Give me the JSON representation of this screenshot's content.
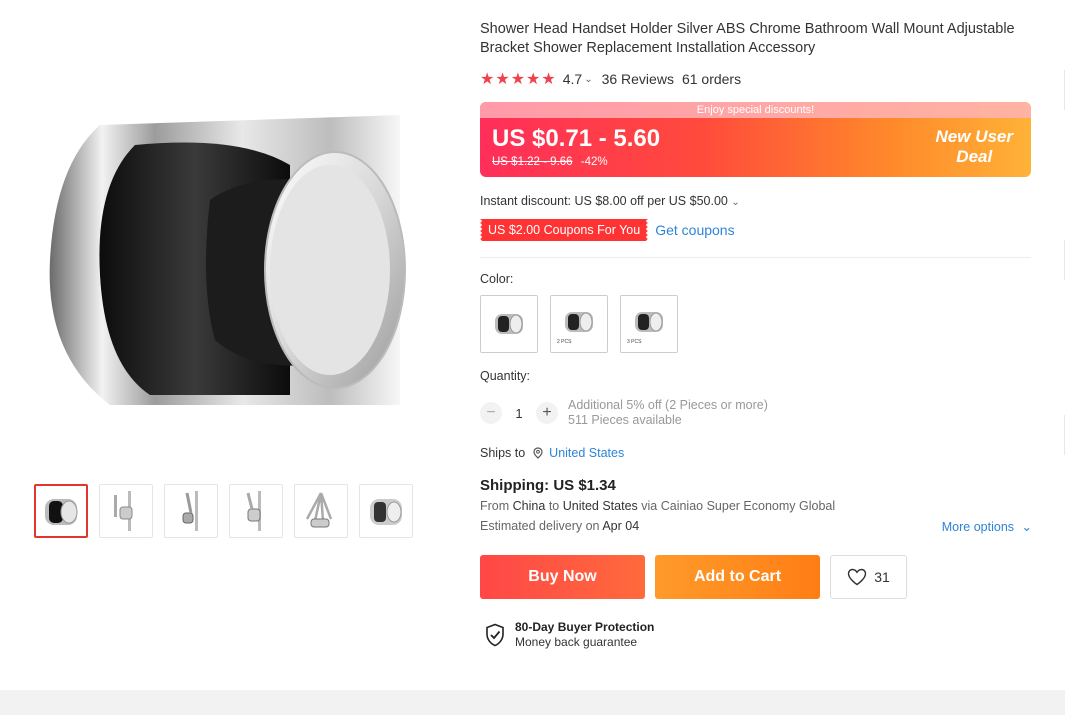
{
  "product": {
    "title": "Shower Head Handset Holder Silver ABS Chrome Bathroom Wall Mount Adjustable Bracket Shower Replacement Installation Accessory",
    "stars": "★★★★★",
    "rating": "4.7",
    "reviews": "36 Reviews",
    "orders": "61 orders"
  },
  "price": {
    "banner": "Enjoy special discounts!",
    "range": "US $0.71 - 5.60",
    "original": "US $1.22 - 9.66",
    "discount": "-42%",
    "deal_line1": "New User",
    "deal_line2": "Deal"
  },
  "discounts": {
    "instant": "Instant discount: US $8.00 off per US $50.00",
    "coupon": "US $2.00 Coupons For You",
    "get_coupons": "Get coupons"
  },
  "color": {
    "label": "Color:",
    "options": [
      "",
      "2 PCS",
      "3 PCS"
    ]
  },
  "quantity": {
    "label": "Quantity:",
    "value": "1",
    "minus": "−",
    "plus": "+",
    "note": "Additional 5% off (2 Pieces or more)",
    "available": "511 Pieces available"
  },
  "shipping": {
    "ships_to_label": "Ships to",
    "country": "United States",
    "title": "Shipping: US $1.34",
    "from_prefix": "From",
    "from": "China",
    "to_word": "to",
    "to": "United States",
    "via": "via Cainiao Super Economy Global",
    "eta_prefix": "Estimated delivery on",
    "eta": "Apr 04",
    "more_options": "More options"
  },
  "actions": {
    "buy_now": "Buy Now",
    "add_to_cart": "Add to Cart",
    "wish_count": "31"
  },
  "protection": {
    "title": "80-Day Buyer Protection",
    "subtitle": "Money back guarantee"
  },
  "colors": {
    "accent_red": "#e2362d",
    "link_blue": "#2e84d8",
    "star": "#f0424c"
  }
}
